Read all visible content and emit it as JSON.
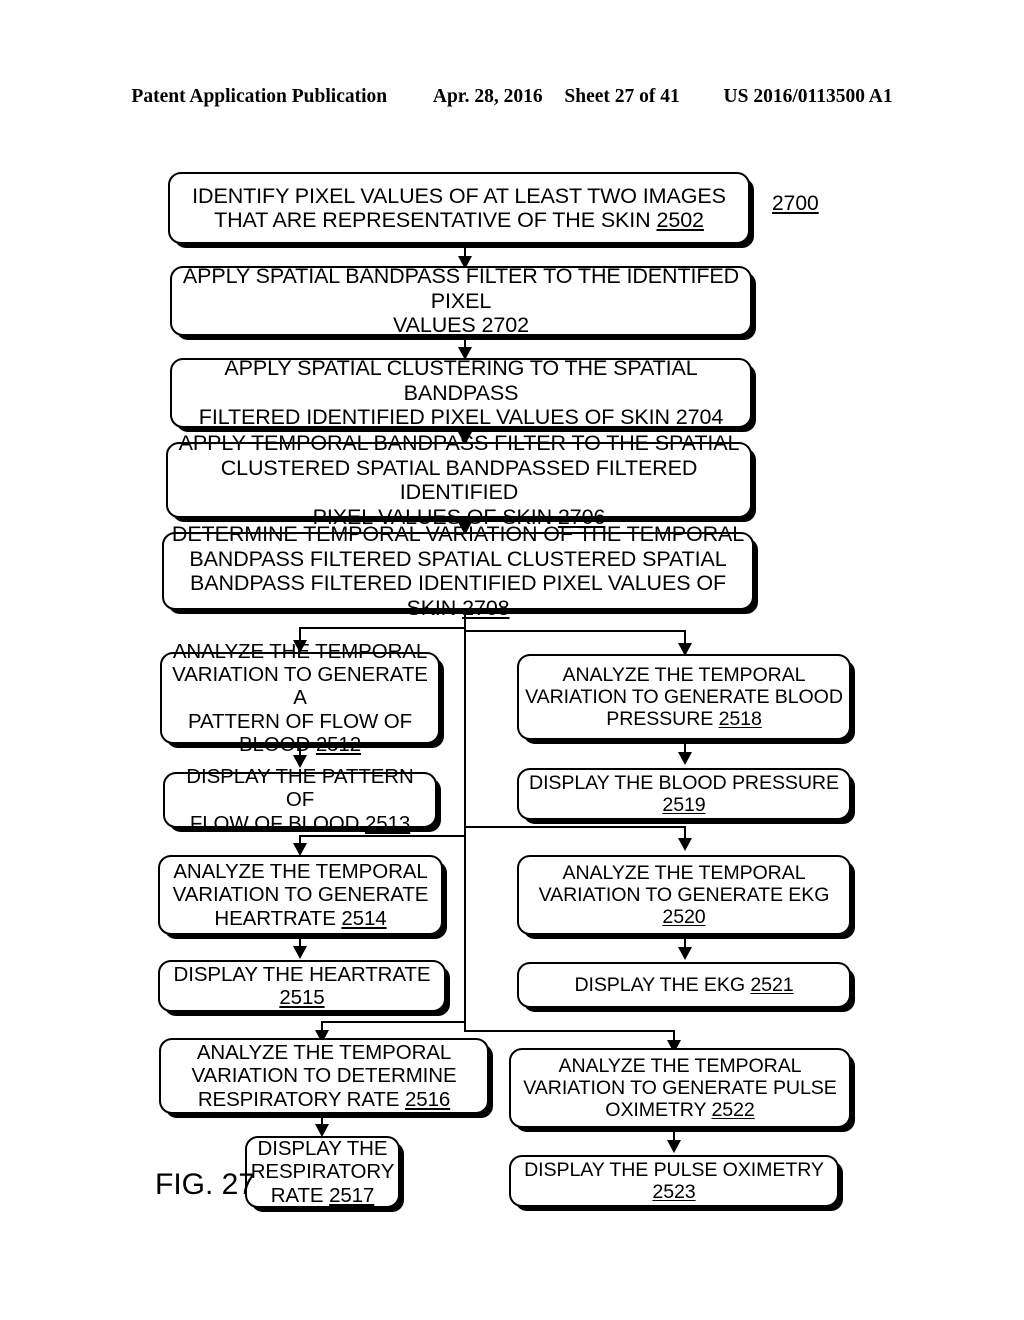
{
  "header": {
    "publication": "Patent Application Publication",
    "date": "Apr. 28, 2016",
    "sheet": "Sheet 27 of 41",
    "doc_number": "US 2016/0113500 A1"
  },
  "figure": {
    "label": "FIG. 27",
    "diagram_reference": "2700"
  },
  "colors": {
    "ink": "#000000",
    "paper": "#ffffff"
  },
  "nodes": {
    "n2502": {
      "ref": "2502",
      "line1": "IDENTIFY PIXEL VALUES OF AT LEAST TWO IMAGES",
      "line2_pre": "THAT ARE REPRESENTATIVE OF THE SKIN "
    },
    "n2702": {
      "ref": "2702",
      "line1": "APPLY SPATIAL BANDPASS FILTER TO THE IDENTIFED PIXEL",
      "line2_pre": "VALUES "
    },
    "n2704": {
      "ref": "2704",
      "line1": "APPLY SPATIAL CLUSTERING TO THE SPATIAL BANDPASS",
      "line2_pre": "FILTERED IDENTIFIED PIXEL VALUES OF SKIN "
    },
    "n2706": {
      "ref": "2706",
      "line1": "APPLY TEMPORAL BANDPASS FILTER TO THE SPATIAL",
      "line2": "CLUSTERED SPATIAL BANDPASSED FILTERED IDENTIFIED",
      "line3_pre": "PIXEL VALUES OF SKIN "
    },
    "n2708": {
      "ref": "2708",
      "line1": "DETERMINE TEMPORAL VARIATION OF THE TEMPORAL",
      "line2": "BANDPASS FILTERED SPATIAL CLUSTERED SPATIAL",
      "line3_pre": "BANDPASS FILTERED IDENTIFIED PIXEL VALUES OF SKIN "
    },
    "n2512": {
      "ref": "2512",
      "line1": "ANALYZE THE TEMPORAL",
      "line2": "VARIATION TO GENERATE A",
      "line3": "PATTERN OF FLOW OF",
      "line4_pre": "BLOOD "
    },
    "n2513": {
      "ref": "2513",
      "line1": "DISPLAY THE PATTERN OF",
      "line2_pre": "FLOW OF BLOOD "
    },
    "n2514": {
      "ref": "2514",
      "line1": "ANALYZE THE TEMPORAL",
      "line2": "VARIATION TO GENERATE",
      "line3_pre": "HEARTRATE "
    },
    "n2515": {
      "ref": "2515",
      "line1": "DISPLAY THE HEARTRATE",
      "line2_pre": ""
    },
    "n2516": {
      "ref": "2516",
      "line1": "ANALYZE THE TEMPORAL",
      "line2": "VARIATION TO DETERMINE",
      "line3_pre": "RESPIRATORY RATE  "
    },
    "n2517": {
      "ref": "2517",
      "line1": "DISPLAY THE",
      "line2": "RESPIRATORY",
      "line3_pre": "RATE  "
    },
    "n2518": {
      "ref": "2518",
      "line1": "ANALYZE THE TEMPORAL",
      "line2": "VARIATION TO GENERATE BLOOD",
      "line3_pre": "PRESSURE "
    },
    "n2519": {
      "ref": "2519",
      "line1": "DISPLAY THE BLOOD PRESSURE",
      "line2_pre": ""
    },
    "n2520": {
      "ref": "2520",
      "line1": "ANALYZE THE TEMPORAL",
      "line2": "VARIATION TO GENERATE EKG",
      "line3_pre": ""
    },
    "n2521": {
      "ref": "2521",
      "line1_pre": "DISPLAY THE EKG "
    },
    "n2522": {
      "ref": "2522",
      "line1": "ANALYZE THE TEMPORAL",
      "line2": "VARIATION TO GENERATE PULSE",
      "line3_pre": "OXIMETRY "
    },
    "n2523": {
      "ref": "2523",
      "line1": "DISPLAY THE PULSE OXIMETRY",
      "line2_pre": ""
    }
  }
}
